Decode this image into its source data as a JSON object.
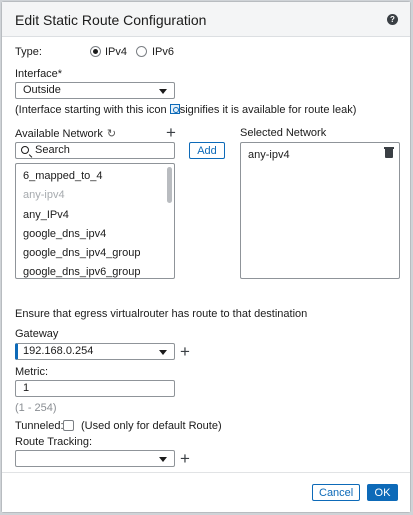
{
  "dialog": {
    "title": "Edit Static Route Configuration",
    "help_symbol": "?"
  },
  "type": {
    "label": "Type:",
    "options": [
      {
        "label": "IPv4",
        "selected": true
      },
      {
        "label": "IPv6",
        "selected": false
      }
    ]
  },
  "interface": {
    "label": "Interface*",
    "value": "Outside",
    "note_before": "(Interface starting with this icon ",
    "note_after": "signifies it is available for route leak)"
  },
  "available_network": {
    "label": "Available Network",
    "search_placeholder": "Search",
    "add_label": "Add",
    "items": [
      {
        "label": "6_mapped_to_4",
        "disabled": false
      },
      {
        "label": "any-ipv4",
        "disabled": true
      },
      {
        "label": "any_IPv4",
        "disabled": false
      },
      {
        "label": "google_dns_ipv4",
        "disabled": false
      },
      {
        "label": "google_dns_ipv4_group",
        "disabled": false
      },
      {
        "label": "google_dns_ipv6_group",
        "disabled": false
      }
    ]
  },
  "selected_network": {
    "label": "Selected Network",
    "items": [
      "any-ipv4"
    ]
  },
  "egress_note": "Ensure that egress virtualrouter has route to that destination",
  "gateway": {
    "label": "Gateway",
    "value": "192.168.0.254"
  },
  "metric": {
    "label": "Metric:",
    "value": "1",
    "range_hint": "(1 - 254)"
  },
  "tunneled": {
    "label": "Tunneled:",
    "checked": false,
    "note": "(Used only for default Route)"
  },
  "route_tracking": {
    "label": "Route Tracking:",
    "value": ""
  },
  "footer": {
    "cancel_label": "Cancel",
    "ok_label": "OK"
  },
  "colors": {
    "accent": "#0d6ab8",
    "header_bg": "#f4f5f6",
    "disabled_text": "#a6aaae"
  }
}
